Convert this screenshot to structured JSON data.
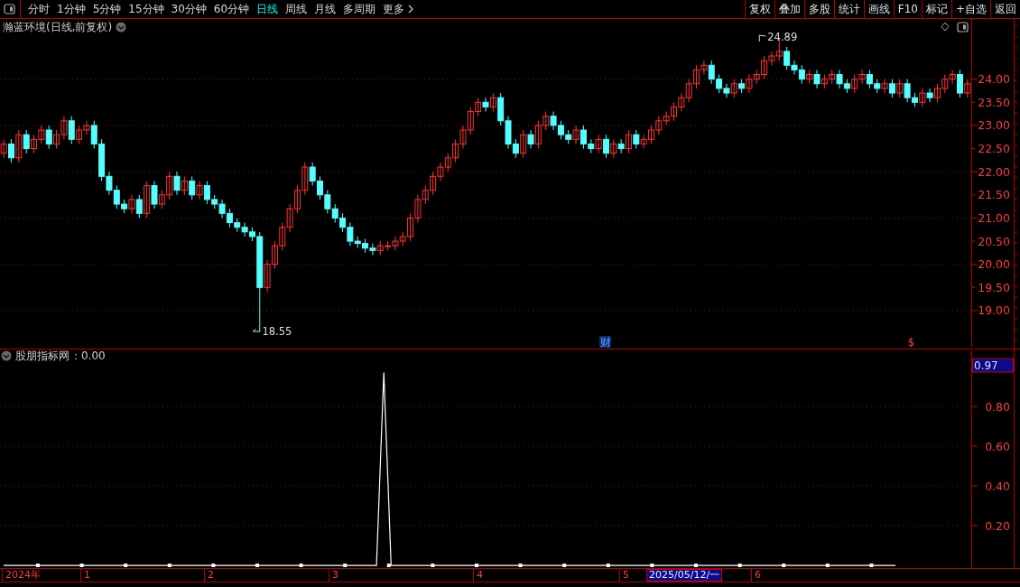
{
  "toolbar": {
    "periods": [
      {
        "label": "分时",
        "selected": false
      },
      {
        "label": "1分钟",
        "selected": false
      },
      {
        "label": "5分钟",
        "selected": false
      },
      {
        "label": "15分钟",
        "selected": false
      },
      {
        "label": "30分钟",
        "selected": false
      },
      {
        "label": "60分钟",
        "selected": false
      },
      {
        "label": "日线",
        "selected": true
      },
      {
        "label": "周线",
        "selected": false
      },
      {
        "label": "月线",
        "selected": false
      },
      {
        "label": "多周期",
        "selected": false
      }
    ],
    "more": "更多",
    "actions": [
      "复权",
      "叠加",
      "多股",
      "统计",
      "画线",
      "F10",
      "标记",
      "+自选",
      "返回"
    ]
  },
  "price_chart": {
    "title": "瀚蓝环境(日线,前复权)",
    "high_label": "24.89",
    "low_label": "18.55",
    "markers": [
      {
        "text": "财",
        "kind": "finance"
      },
      {
        "text": "$",
        "kind": "dividend"
      }
    ],
    "chart_data": {
      "type": "candlestick",
      "ylim": [
        18.18,
        25.3
      ],
      "grid": true,
      "categories": [
        null,
        null,
        null,
        null,
        null,
        null,
        null,
        null,
        null,
        null,
        null,
        null,
        null,
        null,
        null,
        null,
        null,
        null,
        null,
        null,
        null,
        null,
        null,
        null,
        null,
        null,
        null,
        null,
        null,
        null,
        null,
        null,
        null,
        null,
        null,
        null,
        null,
        null,
        null,
        null,
        null,
        null,
        null,
        null,
        null,
        null,
        null,
        null,
        null,
        null,
        null,
        null,
        null,
        null,
        null,
        null,
        null,
        null,
        null,
        null,
        null,
        null,
        null,
        null,
        null,
        null,
        null,
        null,
        null,
        null,
        null,
        null,
        null,
        null,
        null,
        null,
        null,
        null,
        null,
        null,
        null,
        null,
        null,
        null,
        null,
        null,
        null,
        null,
        null,
        null,
        null,
        null,
        null,
        null,
        null,
        null,
        null,
        null,
        null,
        null,
        null,
        null,
        null,
        null,
        null,
        null,
        null,
        null,
        null,
        null,
        null,
        null,
        null,
        null,
        null,
        null,
        null,
        null,
        null,
        null,
        null,
        null,
        null,
        null,
        null,
        null,
        null,
        null,
        null
      ],
      "yticks": [
        {
          "value": 24,
          "label": "24.00"
        },
        {
          "value": 23.5,
          "label": "23.50"
        },
        {
          "value": 23,
          "label": "23.00"
        },
        {
          "value": 22.5,
          "label": "22.50"
        },
        {
          "value": 22,
          "label": "22.00"
        },
        {
          "value": 21.5,
          "label": "21.50"
        },
        {
          "value": 21,
          "label": "21.00"
        },
        {
          "value": 20.5,
          "label": "20.50"
        },
        {
          "value": 20,
          "label": "20.00"
        },
        {
          "value": 19.5,
          "label": "19.50"
        },
        {
          "value": 19,
          "label": "19.00"
        }
      ],
      "ohlc": [
        [
          22.4,
          22.7,
          22.3,
          22.6
        ],
        [
          22.6,
          22.7,
          22.2,
          22.3
        ],
        [
          22.3,
          22.9,
          22.2,
          22.8
        ],
        [
          22.8,
          22.9,
          22.4,
          22.5
        ],
        [
          22.5,
          22.8,
          22.4,
          22.7
        ],
        [
          22.7,
          23.0,
          22.6,
          22.9
        ],
        [
          22.9,
          23.0,
          22.5,
          22.6
        ],
        [
          22.6,
          22.9,
          22.5,
          22.8
        ],
        [
          22.8,
          23.2,
          22.7,
          23.1
        ],
        [
          23.1,
          23.2,
          22.6,
          22.7
        ],
        [
          22.7,
          23.0,
          22.6,
          22.9
        ],
        [
          22.9,
          23.1,
          22.8,
          23.0
        ],
        [
          23.0,
          23.1,
          22.5,
          22.6
        ],
        [
          22.6,
          22.7,
          21.8,
          21.9
        ],
        [
          21.9,
          22.0,
          21.5,
          21.6
        ],
        [
          21.6,
          21.7,
          21.2,
          21.3
        ],
        [
          21.3,
          21.4,
          21.1,
          21.2
        ],
        [
          21.2,
          21.5,
          21.1,
          21.4
        ],
        [
          21.4,
          21.5,
          21.0,
          21.1
        ],
        [
          21.1,
          21.8,
          21.0,
          21.7
        ],
        [
          21.7,
          21.8,
          21.2,
          21.3
        ],
        [
          21.3,
          21.6,
          21.2,
          21.5
        ],
        [
          21.5,
          22.0,
          21.4,
          21.9
        ],
        [
          21.9,
          22.0,
          21.5,
          21.6
        ],
        [
          21.6,
          21.9,
          21.5,
          21.8
        ],
        [
          21.8,
          21.9,
          21.4,
          21.5
        ],
        [
          21.5,
          21.8,
          21.4,
          21.7
        ],
        [
          21.7,
          21.8,
          21.3,
          21.4
        ],
        [
          21.4,
          21.5,
          21.2,
          21.3
        ],
        [
          21.3,
          21.4,
          21.0,
          21.1
        ],
        [
          21.1,
          21.2,
          20.8,
          20.9
        ],
        [
          20.9,
          21.0,
          20.7,
          20.8
        ],
        [
          20.8,
          20.9,
          20.6,
          20.7
        ],
        [
          20.7,
          20.8,
          20.5,
          20.6
        ],
        [
          20.6,
          20.7,
          18.55,
          19.5
        ],
        [
          19.5,
          20.1,
          19.4,
          20.0
        ],
        [
          20.0,
          20.5,
          19.9,
          20.4
        ],
        [
          20.4,
          20.9,
          20.3,
          20.8
        ],
        [
          20.8,
          21.3,
          20.7,
          21.2
        ],
        [
          21.2,
          21.7,
          21.1,
          21.6
        ],
        [
          21.6,
          22.2,
          21.5,
          22.1
        ],
        [
          22.1,
          22.2,
          21.7,
          21.8
        ],
        [
          21.8,
          21.9,
          21.4,
          21.5
        ],
        [
          21.5,
          21.6,
          21.1,
          21.2
        ],
        [
          21.2,
          21.3,
          20.9,
          21.0
        ],
        [
          21.0,
          21.1,
          20.7,
          20.8
        ],
        [
          20.8,
          20.9,
          20.4,
          20.5
        ],
        [
          20.5,
          20.6,
          20.35,
          20.45
        ],
        [
          20.45,
          20.55,
          20.25,
          20.35
        ],
        [
          20.35,
          20.45,
          20.2,
          20.3
        ],
        [
          20.3,
          20.5,
          20.2,
          20.4
        ],
        [
          20.4,
          20.5,
          20.3,
          20.4
        ],
        [
          20.4,
          20.6,
          20.3,
          20.5
        ],
        [
          20.5,
          20.7,
          20.4,
          20.6
        ],
        [
          20.6,
          21.1,
          20.5,
          21.0
        ],
        [
          21.0,
          21.5,
          20.9,
          21.4
        ],
        [
          21.4,
          21.7,
          21.3,
          21.6
        ],
        [
          21.6,
          22.0,
          21.5,
          21.9
        ],
        [
          21.9,
          22.2,
          21.8,
          22.1
        ],
        [
          22.1,
          22.4,
          22.0,
          22.3
        ],
        [
          22.3,
          22.7,
          22.2,
          22.6
        ],
        [
          22.6,
          23.0,
          22.5,
          22.9
        ],
        [
          22.9,
          23.4,
          22.8,
          23.3
        ],
        [
          23.3,
          23.6,
          23.2,
          23.5
        ],
        [
          23.5,
          23.6,
          23.3,
          23.4
        ],
        [
          23.4,
          23.7,
          23.3,
          23.6
        ],
        [
          23.6,
          23.7,
          23.0,
          23.1
        ],
        [
          23.1,
          23.2,
          22.5,
          22.6
        ],
        [
          22.6,
          22.7,
          22.3,
          22.4
        ],
        [
          22.4,
          22.9,
          22.3,
          22.8
        ],
        [
          22.8,
          22.9,
          22.5,
          22.6
        ],
        [
          22.6,
          23.1,
          22.5,
          23.0
        ],
        [
          23.0,
          23.3,
          22.9,
          23.2
        ],
        [
          23.2,
          23.3,
          22.9,
          23.0
        ],
        [
          23.0,
          23.1,
          22.7,
          22.8
        ],
        [
          22.8,
          22.9,
          22.6,
          22.7
        ],
        [
          22.7,
          23.0,
          22.6,
          22.9
        ],
        [
          22.9,
          23.0,
          22.5,
          22.6
        ],
        [
          22.6,
          22.7,
          22.4,
          22.5
        ],
        [
          22.5,
          22.8,
          22.4,
          22.7
        ],
        [
          22.7,
          22.8,
          22.3,
          22.4
        ],
        [
          22.4,
          22.7,
          22.3,
          22.6
        ],
        [
          22.6,
          22.7,
          22.4,
          22.5
        ],
        [
          22.5,
          22.9,
          22.4,
          22.8
        ],
        [
          22.8,
          22.9,
          22.5,
          22.6
        ],
        [
          22.6,
          22.8,
          22.5,
          22.7
        ],
        [
          22.7,
          23.0,
          22.6,
          22.9
        ],
        [
          22.9,
          23.2,
          22.8,
          23.1
        ],
        [
          23.1,
          23.3,
          23.0,
          23.2
        ],
        [
          23.2,
          23.5,
          23.1,
          23.4
        ],
        [
          23.4,
          23.7,
          23.3,
          23.6
        ],
        [
          23.6,
          24.0,
          23.5,
          23.9
        ],
        [
          23.9,
          24.3,
          23.8,
          24.2
        ],
        [
          24.2,
          24.4,
          24.1,
          24.3
        ],
        [
          24.3,
          24.4,
          23.9,
          24.0
        ],
        [
          24.0,
          24.1,
          23.7,
          23.8
        ],
        [
          23.8,
          23.9,
          23.6,
          23.7
        ],
        [
          23.7,
          24.0,
          23.6,
          23.9
        ],
        [
          23.9,
          24.0,
          23.7,
          23.8
        ],
        [
          23.8,
          24.1,
          23.7,
          24.0
        ],
        [
          24.0,
          24.2,
          23.9,
          24.1
        ],
        [
          24.1,
          24.5,
          24.0,
          24.4
        ],
        [
          24.4,
          24.6,
          24.3,
          24.5
        ],
        [
          24.5,
          24.89,
          24.4,
          24.6
        ],
        [
          24.6,
          24.7,
          24.2,
          24.3
        ],
        [
          24.3,
          24.4,
          24.1,
          24.2
        ],
        [
          24.2,
          24.3,
          23.9,
          24.0
        ],
        [
          24.0,
          24.2,
          23.9,
          24.1
        ],
        [
          24.1,
          24.2,
          23.8,
          23.9
        ],
        [
          23.9,
          24.1,
          23.8,
          24.0
        ],
        [
          24.0,
          24.2,
          23.9,
          24.1
        ],
        [
          24.1,
          24.2,
          23.8,
          23.9
        ],
        [
          23.9,
          24.0,
          23.7,
          23.8
        ],
        [
          23.8,
          24.1,
          23.7,
          24.0
        ],
        [
          24.0,
          24.2,
          23.9,
          24.1
        ],
        [
          24.1,
          24.2,
          23.8,
          23.9
        ],
        [
          23.9,
          24.0,
          23.7,
          23.8
        ],
        [
          23.8,
          24.0,
          23.7,
          23.9
        ],
        [
          23.9,
          24.0,
          23.6,
          23.7
        ],
        [
          23.7,
          24.0,
          23.6,
          23.9
        ],
        [
          23.9,
          24.0,
          23.5,
          23.6
        ],
        [
          23.6,
          23.7,
          23.4,
          23.5
        ],
        [
          23.5,
          23.8,
          23.4,
          23.7
        ],
        [
          23.7,
          23.8,
          23.5,
          23.6
        ],
        [
          23.6,
          23.9,
          23.5,
          23.8
        ],
        [
          23.8,
          24.1,
          23.7,
          24.0
        ],
        [
          24.0,
          24.2,
          23.9,
          24.1
        ],
        [
          24.1,
          24.2,
          23.6,
          23.7
        ],
        [
          23.7,
          24.0,
          23.6,
          23.9
        ]
      ]
    }
  },
  "indicator": {
    "value_text": "：0.00",
    "current_value": "0.97",
    "chart_data": {
      "type": "line",
      "ylim": [
        -0.018,
        1.091
      ],
      "grid": true,
      "yticks": [
        {
          "value": 0.2,
          "label": "0.20"
        },
        {
          "value": 0.4,
          "label": "0.40"
        },
        {
          "value": 0.6,
          "label": "0.60"
        },
        {
          "value": 0.8,
          "label": "0.80"
        }
      ],
      "series": [
        {
          "name": "股朋指标网",
          "color": "#ffffff",
          "values": [
            0,
            0,
            0,
            0,
            0,
            0,
            0,
            0,
            0,
            0,
            0,
            0,
            0,
            0,
            0,
            0,
            0,
            0,
            0,
            0,
            0,
            0,
            0,
            0,
            0,
            0,
            0,
            0,
            0,
            0,
            0,
            0,
            0,
            0,
            0,
            0,
            0,
            0,
            0,
            0,
            0,
            0,
            0,
            0,
            0,
            0,
            0,
            0,
            0,
            0,
            0,
            0,
            0.97,
            0,
            0,
            0,
            0,
            0,
            0,
            0,
            0,
            0,
            0,
            0,
            0,
            0,
            0,
            0,
            0,
            0,
            0,
            0,
            0,
            0,
            0,
            0,
            0,
            0,
            0,
            0,
            0,
            0,
            0,
            0,
            0,
            0,
            0,
            0,
            0,
            0,
            0,
            0,
            0,
            0,
            0,
            0,
            0,
            0,
            0,
            0,
            0,
            0,
            0,
            0,
            0,
            0,
            0,
            0,
            0,
            0,
            0,
            0,
            0,
            0,
            0,
            0,
            0,
            0,
            0,
            0,
            0,
            0,
            0
          ]
        }
      ]
    }
  },
  "date_axis": {
    "labels": [
      "2024年",
      "1",
      "2",
      "3",
      "4",
      "5",
      "6"
    ],
    "cursor_date": "2025/05/12/一"
  }
}
